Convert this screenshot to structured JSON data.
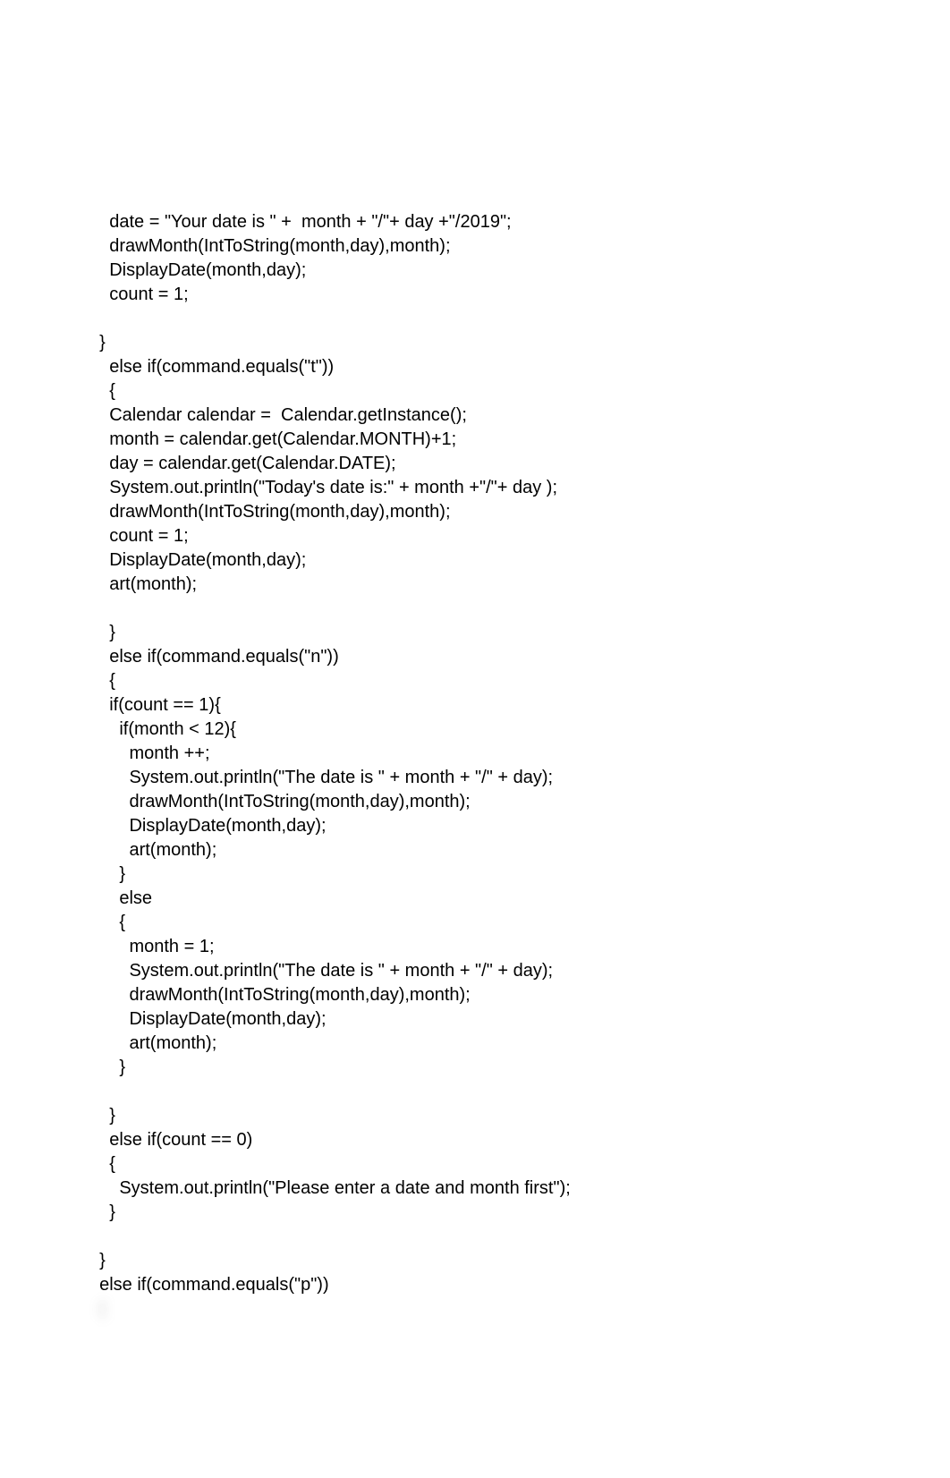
{
  "code": {
    "lines": [
      "    date = \"Your date is \" +  month + \"/\"+ day +\"/2019\";",
      "    drawMonth(IntToString(month,day),month);",
      "    DisplayDate(month,day);",
      "    count = 1;",
      "",
      "  }",
      "    else if(command.equals(\"t\"))",
      "    {",
      "    Calendar calendar =  Calendar.getInstance();",
      "    month = calendar.get(Calendar.MONTH)+1;",
      "    day = calendar.get(Calendar.DATE);",
      "    System.out.println(\"Today's date is:\" + month +\"/\"+ day );",
      "    drawMonth(IntToString(month,day),month);",
      "    count = 1;",
      "    DisplayDate(month,day);",
      "    art(month);",
      "",
      "    }",
      "    else if(command.equals(\"n\"))",
      "    {",
      "    if(count == 1){",
      "      if(month < 12){",
      "        month ++;",
      "        System.out.println(\"The date is \" + month + \"/\" + day);",
      "        drawMonth(IntToString(month,day),month);",
      "        DisplayDate(month,day);",
      "        art(month);",
      "      }",
      "      else",
      "      {",
      "        month = 1;",
      "        System.out.println(\"The date is \" + month + \"/\" + day);",
      "        drawMonth(IntToString(month,day),month);",
      "        DisplayDate(month,day);",
      "        art(month);",
      "      }",
      "",
      "    }",
      "    else if(count == 0)",
      "    {",
      "      System.out.println(\"Please enter a date and month first\");",
      "    }",
      "",
      "  }",
      "  else if(command.equals(\"p\"))"
    ],
    "blurred_line": "  {"
  }
}
